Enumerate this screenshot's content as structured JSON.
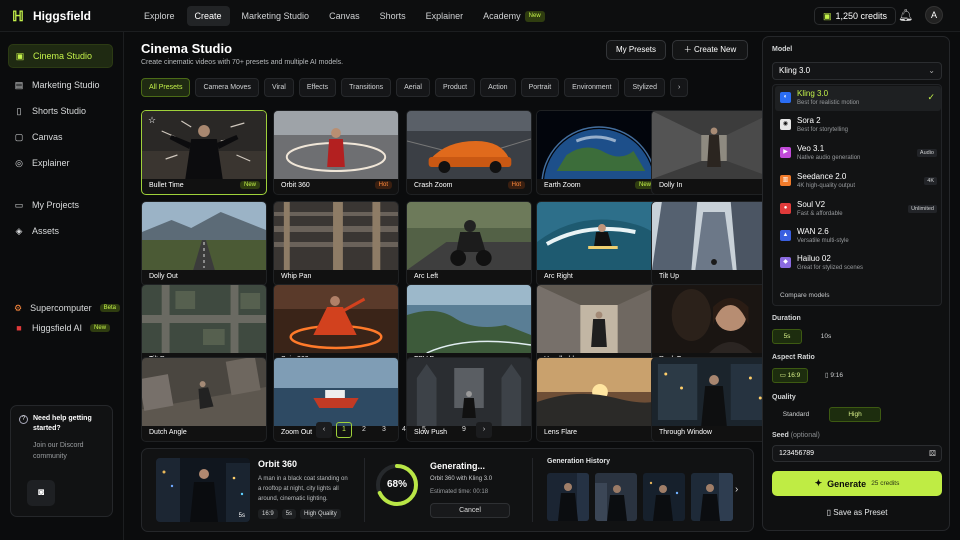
{
  "brand": {
    "name": "Higgsfield",
    "logo_icon": "hf-logo",
    "accent": "#c4f24a"
  },
  "topnav": {
    "items": [
      {
        "label": "Explore"
      },
      {
        "label": "Create",
        "active": true
      },
      {
        "label": "Marketing Studio"
      },
      {
        "label": "Canvas"
      },
      {
        "label": "Shorts"
      },
      {
        "label": "Explainer"
      },
      {
        "label": "Academy",
        "badge": "New"
      }
    ],
    "credits": "1,250 credits",
    "avatar_initial": "A"
  },
  "sidebar": {
    "items": [
      {
        "label": "Cinema Studio",
        "icon": "film-icon",
        "active": true
      },
      {
        "label": "Marketing Studio",
        "icon": "briefcase-icon"
      },
      {
        "label": "Shorts Studio",
        "icon": "phone-icon"
      },
      {
        "label": "Canvas",
        "icon": "canvas-icon"
      },
      {
        "label": "Explainer",
        "icon": "lightbulb-icon"
      },
      {
        "label": "My Projects",
        "icon": "folder-icon"
      },
      {
        "label": "Assets",
        "icon": "layers-icon"
      },
      {
        "label": "Supercomputer",
        "icon": "cpu-icon",
        "badge": "Beta"
      },
      {
        "label": "Higgsfield AI",
        "icon": "sparkle-icon",
        "badge": "New"
      }
    ],
    "help": {
      "title": "Need help getting started?",
      "text": "Join our Discord community"
    }
  },
  "header": {
    "title": "Cinema Studio",
    "subtitle": "Create cinematic videos with 70+ presets and multiple AI models.",
    "my_presets": "My Presets",
    "create_new": "Create New"
  },
  "filters": [
    "All Presets",
    "Camera Moves",
    "Viral",
    "Effects",
    "Transitions",
    "Aerial",
    "Product",
    "Action",
    "Portrait",
    "Environment",
    "Stylized"
  ],
  "presets": [
    {
      "name": "Bullet Time",
      "tag": "New",
      "tag_type": "new",
      "selected": true,
      "scene": "bullet"
    },
    {
      "name": "Orbit 360",
      "tag": "Hot",
      "tag_type": "hot",
      "scene": "orbit"
    },
    {
      "name": "Crash Zoom",
      "tag": "Hot",
      "tag_type": "hot",
      "scene": "car"
    },
    {
      "name": "Earth Zoom",
      "tag": "New",
      "tag_type": "new",
      "scene": "earth"
    },
    {
      "name": "Dolly In",
      "scene": "hall"
    },
    {
      "name": "Dolly Out",
      "scene": "road"
    },
    {
      "name": "Whip Pan",
      "scene": "blur"
    },
    {
      "name": "Arc Left",
      "scene": "moto"
    },
    {
      "name": "Arc Right",
      "scene": "surf"
    },
    {
      "name": "Tilt Up",
      "scene": "city"
    },
    {
      "name": "Tilt Down",
      "scene": "aerial"
    },
    {
      "name": "Spin 360",
      "scene": "dance"
    },
    {
      "name": "FPV Drone",
      "scene": "coast"
    },
    {
      "name": "Handheld",
      "scene": "street"
    },
    {
      "name": "Rack Focus",
      "scene": "portrait"
    },
    {
      "name": "Dutch Angle",
      "scene": "dutch"
    },
    {
      "name": "Zoom Out",
      "scene": "boat"
    },
    {
      "name": "Slow Push",
      "scene": "cathedral"
    },
    {
      "name": "Lens Flare",
      "scene": "sunset"
    },
    {
      "name": "Through Window",
      "scene": "window"
    }
  ],
  "pager": {
    "pages": [
      "1",
      "2",
      "3",
      "4",
      "5",
      "...",
      "9"
    ],
    "current": "1"
  },
  "generation": {
    "preset": "Orbit 360",
    "prompt": "A man in a black coat standing on a rooftop at night, city lights all around, cinematic lighting.",
    "thumb_duration": "5s",
    "tags": [
      "16:9",
      "5s",
      "High Quality"
    ],
    "progress": 0.68,
    "progress_label": "68%",
    "status": "Generating...",
    "model_line": "Orbit 360 with Kling 3.0",
    "eta": "Estimated time: 00:18",
    "cancel": "Cancel",
    "history_title": "Generation History"
  },
  "panel": {
    "model_label": "Model",
    "model_selected": "Kling 3.0",
    "models": [
      {
        "name": "Kling 3.0",
        "desc": "Best for realistic motion",
        "icon_color": "#2a6df4",
        "selected": true
      },
      {
        "name": "Sora 2",
        "desc": "Best for storytelling",
        "icon_color": "#e8e8e8"
      },
      {
        "name": "Veo 3.1",
        "desc": "Native audio generation",
        "badge": "Audio",
        "icon_color": "#c04ad8"
      },
      {
        "name": "Seedance 2.0",
        "desc": "4K high-quality output",
        "badge": "4K",
        "icon_color": "#f07a2a"
      },
      {
        "name": "Soul V2",
        "desc": "Fast & affordable",
        "badge": "Unlimited",
        "icon_color": "#e03a3a"
      },
      {
        "name": "WAN 2.6",
        "desc": "Versatile multi-style",
        "icon_color": "#3a5fe0"
      },
      {
        "name": "Hailuo 02",
        "desc": "Great for stylized scenes",
        "icon_color": "#8a6ae0"
      }
    ],
    "compare": "Compare models",
    "duration_label": "Duration",
    "durations": [
      "5s",
      "10s"
    ],
    "aspect_label": "Aspect Ratio",
    "aspects": [
      "16:9",
      "9:16"
    ],
    "quality_label": "Quality",
    "qualities": [
      "Standard",
      "High"
    ],
    "seed_label": "Seed",
    "seed_optional": "(optional)",
    "seed_value": "123456789",
    "generate": "Generate",
    "generate_cost": "25 credits",
    "save_preset": "Save as Preset"
  }
}
